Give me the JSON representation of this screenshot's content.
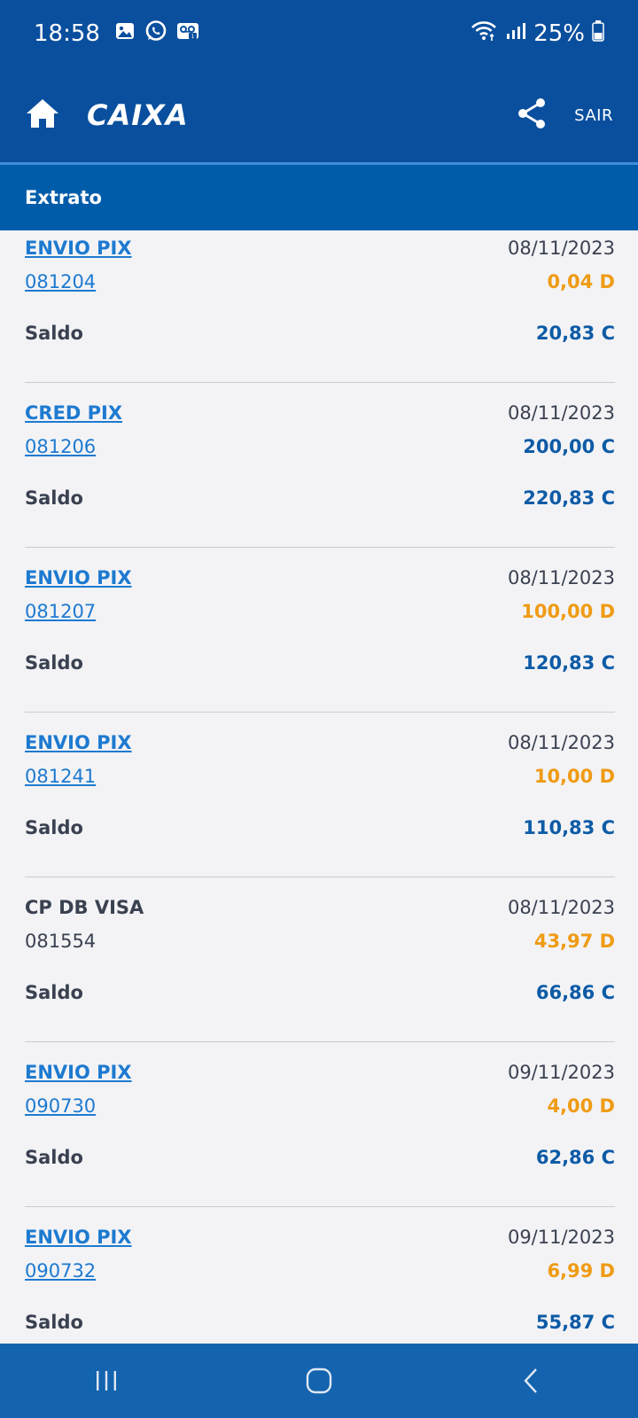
{
  "status_bar": {
    "time": "18:58",
    "battery": "25%",
    "icons": [
      "gallery-icon",
      "whatsapp-icon",
      "voicemail-icon",
      "wifi-icon",
      "signal-icon",
      "battery-icon"
    ]
  },
  "app_bar": {
    "brand": "CAIXA",
    "home_icon": "home-icon",
    "share_icon": "share-icon",
    "logout_label": "SAIR"
  },
  "sub_header": {
    "title": "Extrato"
  },
  "colors": {
    "primary": "#0a4f9e",
    "subheader": "#005ca9",
    "link": "#1d7ad0",
    "debit": "#ef9b14",
    "credit": "#0d5ba6",
    "accent": "#f7a600"
  },
  "entries": [
    {
      "title": "ENVIO PIX",
      "doc": "081204",
      "date": "08/11/2023",
      "amount": "0,04 D",
      "type": "debit",
      "saldo_label": "Saldo",
      "saldo": "20,83 C",
      "link": true
    },
    {
      "title": "CRED PIX",
      "doc": "081206",
      "date": "08/11/2023",
      "amount": "200,00 C",
      "type": "credit",
      "saldo_label": "Saldo",
      "saldo": "220,83 C",
      "link": true
    },
    {
      "title": "ENVIO PIX",
      "doc": "081207",
      "date": "08/11/2023",
      "amount": "100,00 D",
      "type": "debit",
      "saldo_label": "Saldo",
      "saldo": "120,83 C",
      "link": true
    },
    {
      "title": "ENVIO PIX",
      "doc": "081241",
      "date": "08/11/2023",
      "amount": "10,00 D",
      "type": "debit",
      "saldo_label": "Saldo",
      "saldo": "110,83 C",
      "link": true
    },
    {
      "title": "CP DB VISA",
      "doc": "081554",
      "date": "08/11/2023",
      "amount": "43,97 D",
      "type": "debit",
      "saldo_label": "Saldo",
      "saldo": "66,86 C",
      "link": false
    },
    {
      "title": "ENVIO PIX",
      "doc": "090730",
      "date": "09/11/2023",
      "amount": "4,00 D",
      "type": "debit",
      "saldo_label": "Saldo",
      "saldo": "62,86 C",
      "link": true
    },
    {
      "title": "ENVIO PIX",
      "doc": "090732",
      "date": "09/11/2023",
      "amount": "6,99 D",
      "type": "debit",
      "saldo_label": "Saldo",
      "saldo": "55,87 C",
      "link": true
    }
  ],
  "nav_bar": {
    "buttons": [
      "recent-apps-icon",
      "home-button-icon",
      "back-icon"
    ]
  }
}
